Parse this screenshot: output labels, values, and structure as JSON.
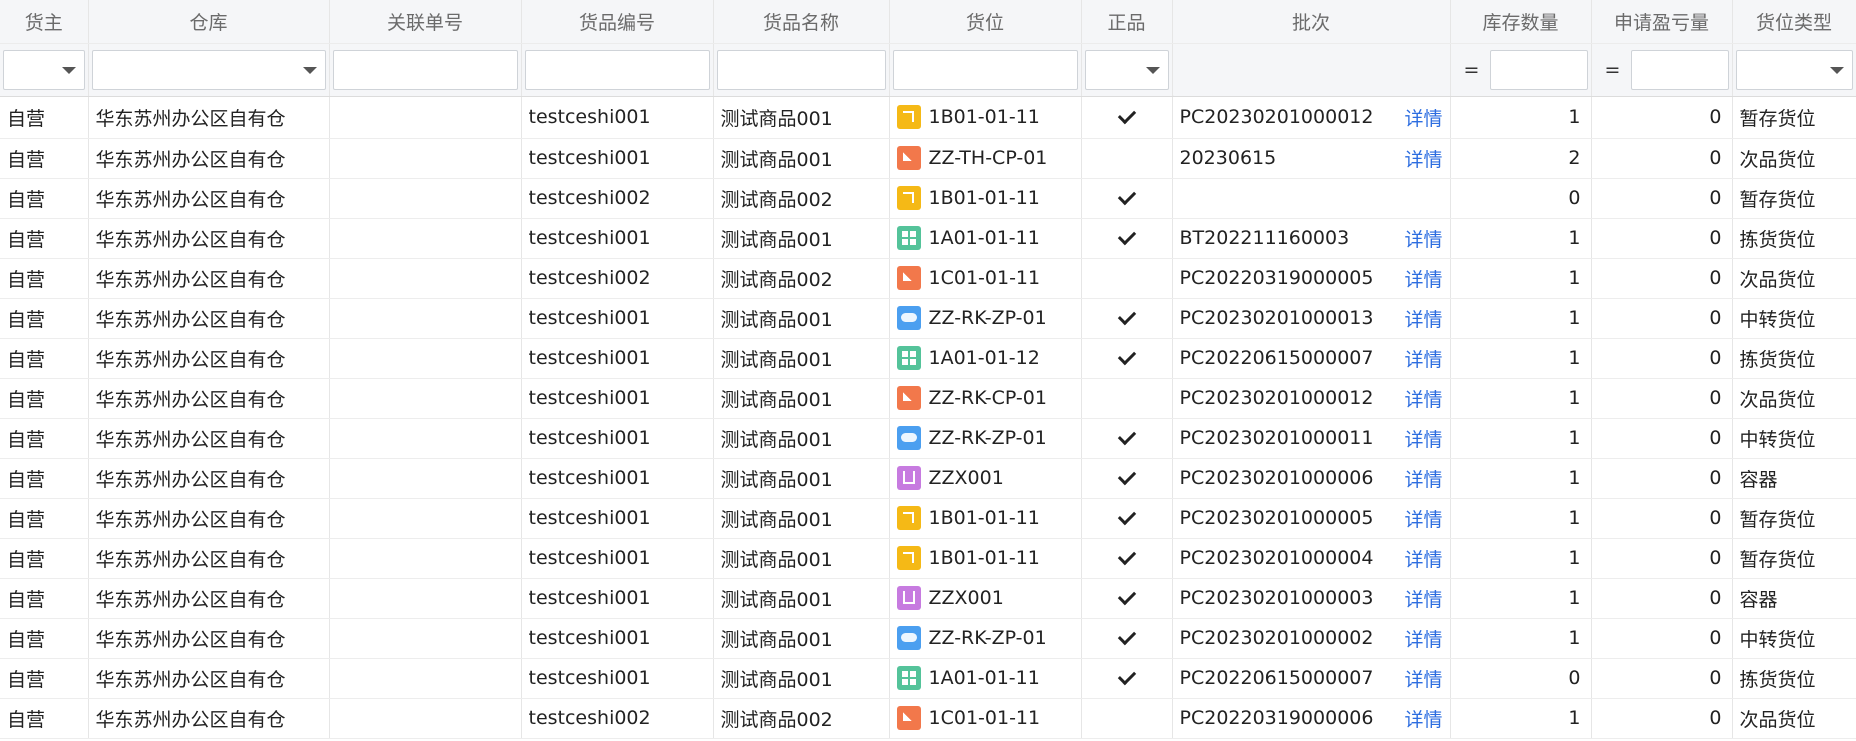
{
  "columns": {
    "c0": "货主",
    "c1": "仓库",
    "c2": "关联单号",
    "c3": "货品编号",
    "c4": "货品名称",
    "c5": "货位",
    "c6": "正品",
    "c7": "批次",
    "c8": "库存数量",
    "c9": "申请盈亏量",
    "c10": "货位类型"
  },
  "filters": {
    "eq1": "=",
    "eq2": "="
  },
  "detail_label": "详情",
  "rows": [
    {
      "owner": "自营",
      "warehouse": "华东苏州办公区自有仓",
      "ref": "",
      "code": "testceshi001",
      "name": "测试商品001",
      "loc_icon": "yellow",
      "loc": "1B01-01-11",
      "genuine": true,
      "batch": "PC20230201000012",
      "detail": true,
      "qty": "1",
      "apply": "0",
      "loc_type": "暂存货位"
    },
    {
      "owner": "自营",
      "warehouse": "华东苏州办公区自有仓",
      "ref": "",
      "code": "testceshi001",
      "name": "测试商品001",
      "loc_icon": "orange",
      "loc": "ZZ-TH-CP-01",
      "genuine": false,
      "batch": "20230615",
      "detail": true,
      "qty": "2",
      "apply": "0",
      "loc_type": "次品货位"
    },
    {
      "owner": "自营",
      "warehouse": "华东苏州办公区自有仓",
      "ref": "",
      "code": "testceshi002",
      "name": "测试商品002",
      "loc_icon": "yellow",
      "loc": "1B01-01-11",
      "genuine": true,
      "batch": "",
      "detail": false,
      "qty": "0",
      "apply": "0",
      "loc_type": "暂存货位"
    },
    {
      "owner": "自营",
      "warehouse": "华东苏州办公区自有仓",
      "ref": "",
      "code": "testceshi001",
      "name": "测试商品001",
      "loc_icon": "green",
      "loc": "1A01-01-11",
      "genuine": true,
      "batch": "BT202211160003",
      "detail": true,
      "qty": "1",
      "apply": "0",
      "loc_type": "拣货货位"
    },
    {
      "owner": "自营",
      "warehouse": "华东苏州办公区自有仓",
      "ref": "",
      "code": "testceshi002",
      "name": "测试商品002",
      "loc_icon": "orange",
      "loc": "1C01-01-11",
      "genuine": false,
      "batch": "PC20220319000005",
      "detail": true,
      "qty": "1",
      "apply": "0",
      "loc_type": "次品货位"
    },
    {
      "owner": "自营",
      "warehouse": "华东苏州办公区自有仓",
      "ref": "",
      "code": "testceshi001",
      "name": "测试商品001",
      "loc_icon": "blue",
      "loc": "ZZ-RK-ZP-01",
      "genuine": true,
      "batch": "PC20230201000013",
      "detail": true,
      "qty": "1",
      "apply": "0",
      "loc_type": "中转货位"
    },
    {
      "owner": "自营",
      "warehouse": "华东苏州办公区自有仓",
      "ref": "",
      "code": "testceshi001",
      "name": "测试商品001",
      "loc_icon": "green",
      "loc": "1A01-01-12",
      "genuine": true,
      "batch": "PC20220615000007",
      "detail": true,
      "qty": "1",
      "apply": "0",
      "loc_type": "拣货货位"
    },
    {
      "owner": "自营",
      "warehouse": "华东苏州办公区自有仓",
      "ref": "",
      "code": "testceshi001",
      "name": "测试商品001",
      "loc_icon": "orange",
      "loc": "ZZ-RK-CP-01",
      "genuine": false,
      "batch": "PC20230201000012",
      "detail": true,
      "qty": "1",
      "apply": "0",
      "loc_type": "次品货位"
    },
    {
      "owner": "自营",
      "warehouse": "华东苏州办公区自有仓",
      "ref": "",
      "code": "testceshi001",
      "name": "测试商品001",
      "loc_icon": "blue",
      "loc": "ZZ-RK-ZP-01",
      "genuine": true,
      "batch": "PC20230201000011",
      "detail": true,
      "qty": "1",
      "apply": "0",
      "loc_type": "中转货位"
    },
    {
      "owner": "自营",
      "warehouse": "华东苏州办公区自有仓",
      "ref": "",
      "code": "testceshi001",
      "name": "测试商品001",
      "loc_icon": "purple",
      "loc": "ZZX001",
      "genuine": true,
      "batch": "PC20230201000006",
      "detail": true,
      "qty": "1",
      "apply": "0",
      "loc_type": "容器"
    },
    {
      "owner": "自营",
      "warehouse": "华东苏州办公区自有仓",
      "ref": "",
      "code": "testceshi001",
      "name": "测试商品001",
      "loc_icon": "yellow",
      "loc": "1B01-01-11",
      "genuine": true,
      "batch": "PC20230201000005",
      "detail": true,
      "qty": "1",
      "apply": "0",
      "loc_type": "暂存货位"
    },
    {
      "owner": "自营",
      "warehouse": "华东苏州办公区自有仓",
      "ref": "",
      "code": "testceshi001",
      "name": "测试商品001",
      "loc_icon": "yellow",
      "loc": "1B01-01-11",
      "genuine": true,
      "batch": "PC20230201000004",
      "detail": true,
      "qty": "1",
      "apply": "0",
      "loc_type": "暂存货位"
    },
    {
      "owner": "自营",
      "warehouse": "华东苏州办公区自有仓",
      "ref": "",
      "code": "testceshi001",
      "name": "测试商品001",
      "loc_icon": "purple",
      "loc": "ZZX001",
      "genuine": true,
      "batch": "PC20230201000003",
      "detail": true,
      "qty": "1",
      "apply": "0",
      "loc_type": "容器"
    },
    {
      "owner": "自营",
      "warehouse": "华东苏州办公区自有仓",
      "ref": "",
      "code": "testceshi001",
      "name": "测试商品001",
      "loc_icon": "blue",
      "loc": "ZZ-RK-ZP-01",
      "genuine": true,
      "batch": "PC20230201000002",
      "detail": true,
      "qty": "1",
      "apply": "0",
      "loc_type": "中转货位"
    },
    {
      "owner": "自营",
      "warehouse": "华东苏州办公区自有仓",
      "ref": "",
      "code": "testceshi001",
      "name": "测试商品001",
      "loc_icon": "green",
      "loc": "1A01-01-11",
      "genuine": true,
      "batch": "PC20220615000007",
      "detail": true,
      "qty": "0",
      "apply": "0",
      "loc_type": "拣货货位"
    },
    {
      "owner": "自营",
      "warehouse": "华东苏州办公区自有仓",
      "ref": "",
      "code": "testceshi002",
      "name": "测试商品002",
      "loc_icon": "orange",
      "loc": "1C01-01-11",
      "genuine": false,
      "batch": "PC20220319000006",
      "detail": true,
      "qty": "1",
      "apply": "0",
      "loc_type": "次品货位"
    }
  ]
}
